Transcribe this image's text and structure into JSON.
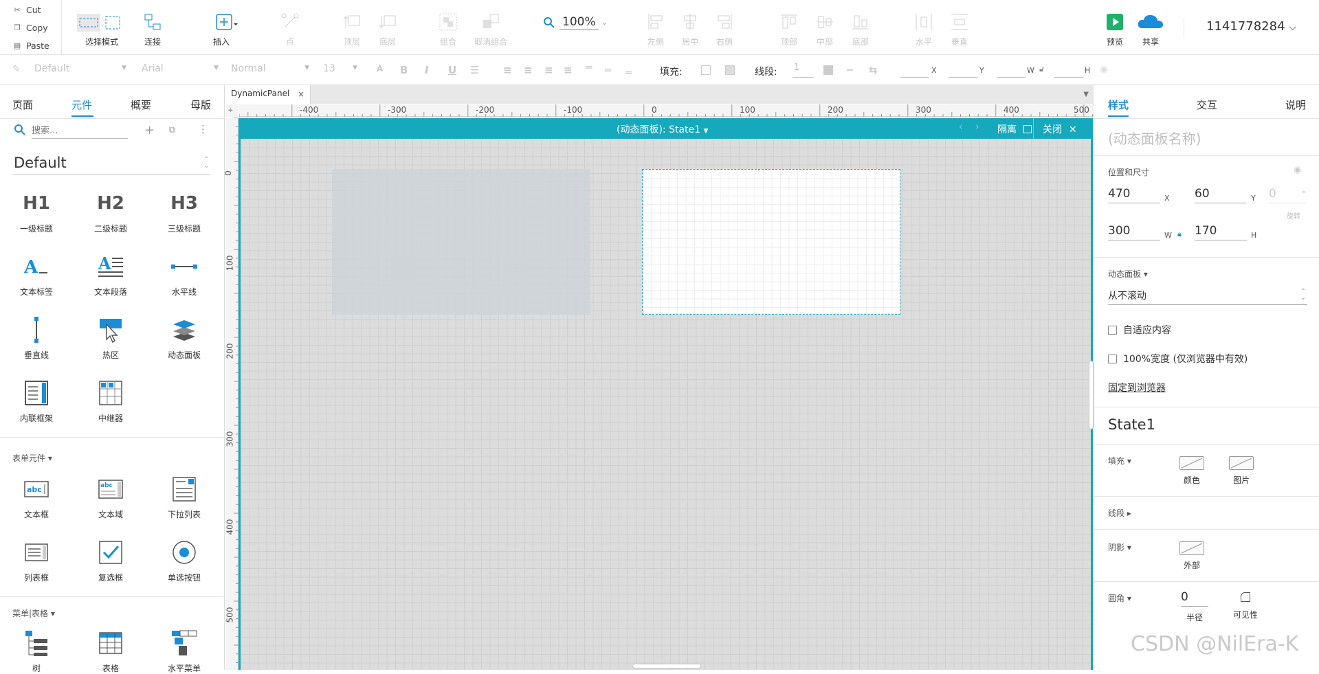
{
  "clipboard": {
    "cut": "Cut",
    "copy": "Copy",
    "paste": "Paste"
  },
  "toolbar": {
    "select_mode": "选择模式",
    "connect": "连接",
    "insert": "插入",
    "point": "点",
    "top_layer": "顶层",
    "bottom_layer": "底层",
    "group": "组合",
    "ungroup": "取消组合",
    "zoom": "100%",
    "align_left": "左侧",
    "align_center": "居中",
    "align_right": "右侧",
    "align_top": "顶部",
    "align_middle": "中部",
    "align_bottom": "底部",
    "dist_h": "水平",
    "dist_v": "垂直",
    "preview": "预览",
    "share": "共享",
    "user": "1141778284"
  },
  "format": {
    "style": "Default",
    "font": "Arial",
    "weight": "Normal",
    "size": "13",
    "fill_label": "填充:",
    "stroke_label": "线段:",
    "stroke_value": "1",
    "x": "X",
    "y": "Y",
    "w": "W",
    "h": "H"
  },
  "left": {
    "tabs": [
      "页面",
      "元件",
      "概要",
      "母版"
    ],
    "search_placeholder": "搜索...",
    "library": "Default",
    "widgets": [
      "一级标题",
      "二级标题",
      "三级标题",
      "文本标签",
      "文本段落",
      "水平线",
      "垂直线",
      "热区",
      "动态面板",
      "内联框架",
      "中继器"
    ],
    "h_icons": [
      "H1",
      "H2",
      "H3"
    ],
    "form_section": "表单元件 ▾",
    "form_widgets": [
      "文本框",
      "文本域",
      "下拉列表",
      "列表框",
      "复选框",
      "单选按钮"
    ],
    "menu_section": "菜单|表格 ▾",
    "menu_widgets": [
      "树",
      "表格",
      "水平菜单"
    ]
  },
  "canvas": {
    "tab": "DynamicPanel",
    "panel_title": "(动态面板): State1",
    "isolate": "隔离",
    "close": "关闭",
    "hruler": [
      "-400",
      "-300",
      "-200",
      "-100",
      "0",
      "100",
      "200",
      "300",
      "400",
      "500"
    ],
    "vruler": [
      "0",
      "100",
      "200",
      "300",
      "400",
      "500"
    ]
  },
  "right": {
    "tabs": [
      "样式",
      "交互",
      "说明"
    ],
    "name_placeholder": "(动态面板名称)",
    "pos_size": "位置和尺寸",
    "x": "470",
    "y": "60",
    "rot": "0",
    "w": "300",
    "h": "170",
    "x_lbl": "X",
    "y_lbl": "Y",
    "w_lbl": "W",
    "h_lbl": "H",
    "rot_lbl": "旋转",
    "deg": "°",
    "dp_label": "动态面板 ▾",
    "scroll": "从不滚动",
    "fit": "自适应内容",
    "fullwidth": "100%宽度 (仅浏览器中有效)",
    "pin": "固定到浏览器",
    "state": "State1",
    "fill": "填充 ▾",
    "fill_color": "颜色",
    "fill_image": "图片",
    "stroke": "线段 ▸",
    "shadow": "阴影 ▾",
    "shadow_outer": "外部",
    "radius": "圆角 ▾",
    "radius_val": "0",
    "radius_lbl": "半径",
    "visibility": "可见性"
  },
  "watermark": "CSDN @NilEra-K"
}
